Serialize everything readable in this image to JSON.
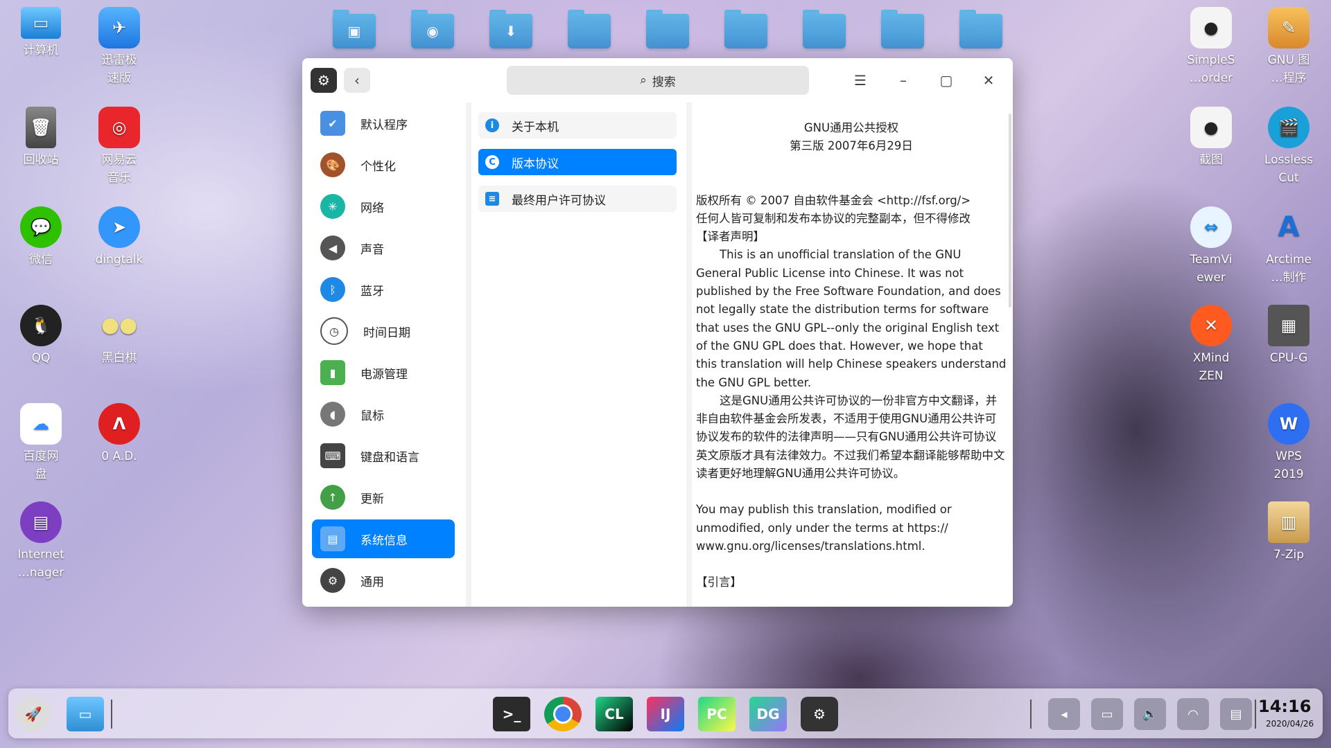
{
  "desktop": {
    "left_icons": [
      {
        "label": "计算机"
      },
      {
        "label": "迅雷极\n速版"
      },
      {
        "label": "回收站"
      },
      {
        "label": "网易云\n音乐"
      },
      {
        "label": "微信"
      },
      {
        "label": "dingtalk"
      },
      {
        "label": "QQ"
      },
      {
        "label": "黑白棋"
      },
      {
        "label": "百度网\n盘"
      },
      {
        "label": "0 A.D."
      },
      {
        "label": "Internet\n…nager"
      }
    ],
    "right_icons": [
      {
        "label": "SimpleS\n…order"
      },
      {
        "label": "GNU 图\n…程序"
      },
      {
        "label": "截图"
      },
      {
        "label": "Lossless\nCut"
      },
      {
        "label": "TeamVi\newer"
      },
      {
        "label": "Arctime\n…制作"
      },
      {
        "label": "XMind\nZEN"
      },
      {
        "label": "CPU-G"
      },
      {
        "label": "WPS\n2019"
      },
      {
        "label": "7-Zip"
      }
    ]
  },
  "window": {
    "search_placeholder": "搜索",
    "sidebar": [
      {
        "label": "默认程序"
      },
      {
        "label": "个性化"
      },
      {
        "label": "网络"
      },
      {
        "label": "声音"
      },
      {
        "label": "蓝牙"
      },
      {
        "label": "时间日期"
      },
      {
        "label": "电源管理"
      },
      {
        "label": "鼠标"
      },
      {
        "label": "键盘和语言"
      },
      {
        "label": "更新"
      },
      {
        "label": "系统信息"
      },
      {
        "label": "通用"
      }
    ],
    "sidebar_active": "系统信息",
    "sub_menu": [
      {
        "label": "关于本机",
        "icon": "i"
      },
      {
        "label": "版本协议",
        "icon": "C"
      },
      {
        "label": "最终用户许可协议",
        "icon": "≡"
      }
    ],
    "sub_active": "版本协议",
    "license": {
      "title": "GNU通用公共授权",
      "version": "第三版 2007年6月29日",
      "copyright": "版权所有 © 2007 自由软件基金会 <http://fsf.org/>",
      "copy_notice": "任何人皆可复制和发布本协议的完整副本，但不得修改",
      "translator_note": "【译者声明】",
      "para_en": "This is an unofficial translation of the GNU General Public License into Chinese. It was not published by the Free Software Foundation, and does not legally state the distribution terms for software that uses the GNU GPL--only the original English text of the GNU GPL does that. However, we hope that this translation will help Chinese speakers understand the GNU GPL better.",
      "para_zh": "这是GNU通用公共许可协议的一份非官方中文翻译，并非自由软件基金会所发表，不适用于使用GNU通用公共许可协议发布的软件的法律声明——只有GNU通用公共许可协议英文原版才具有法律效力。不过我们希望本翻译能够帮助中文读者更好地理解GNU通用公共许可协议。",
      "para_publish": "You may publish this translation, modified or unmodified, only under the terms at https:// www.gnu.org/licenses/translations.html.",
      "next_heading": "【引言】"
    }
  },
  "taskbar": {
    "apps": [
      {
        "label": "terminal"
      },
      {
        "label": "chrome"
      },
      {
        "label": "CL"
      },
      {
        "label": "IJ"
      },
      {
        "label": "PC"
      },
      {
        "label": "DG"
      },
      {
        "label": "settings"
      }
    ],
    "time": "14:16",
    "date": "2020/04/26"
  },
  "colors": {
    "accent": "#0081ff"
  }
}
